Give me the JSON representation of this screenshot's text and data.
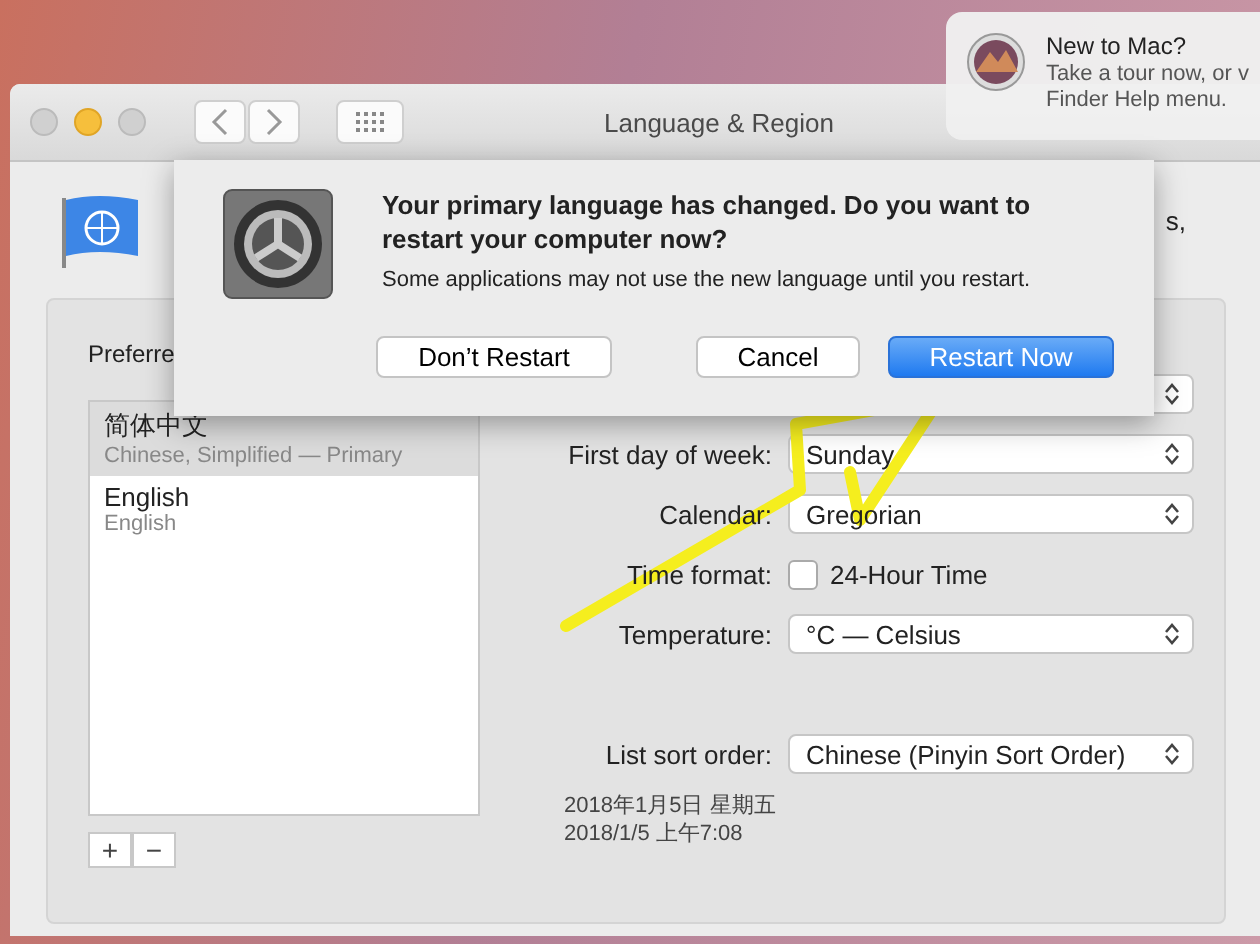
{
  "notification": {
    "title": "New to Mac?",
    "lines": [
      "Take a tour now, or v",
      "Finder Help menu."
    ]
  },
  "window": {
    "title": "Language & Region",
    "header_text": "s,",
    "preferred_label": "Preferre",
    "languages": [
      {
        "name": "简体中文",
        "detail": "Chinese, Simplified — Primary",
        "selected": true
      },
      {
        "name": "English",
        "detail": "English",
        "selected": false
      }
    ],
    "list_buttons": [
      "+",
      "−"
    ],
    "settings": [
      {
        "kind": "popup"
      },
      {
        "kind": "popup",
        "label": "First day of week:",
        "value": "Sunday"
      },
      {
        "kind": "popup",
        "label": "Calendar:",
        "value": "Gregorian"
      },
      {
        "kind": "checkbox",
        "label": "Time format:",
        "text": "24-Hour Time",
        "checked": false
      },
      {
        "kind": "popup",
        "label": "Temperature:",
        "value": "°C — Celsius"
      },
      {
        "kind": "gap"
      },
      {
        "kind": "popup",
        "label": "List sort order:",
        "value": "Chinese (Pinyin Sort Order)"
      }
    ],
    "date_samples": [
      "2018年1月5日 星期五",
      "2018/1/5 上午7:08"
    ]
  },
  "dialog": {
    "title": "Your primary language has changed. Do you want to restart your computer now?",
    "message": "Some applications may not use the new language until you restart.",
    "buttons": [
      {
        "label": "Don’t Restart",
        "default": false
      },
      {
        "label": "Cancel",
        "default": false
      },
      {
        "label": "Restart Now",
        "default": true
      }
    ]
  }
}
